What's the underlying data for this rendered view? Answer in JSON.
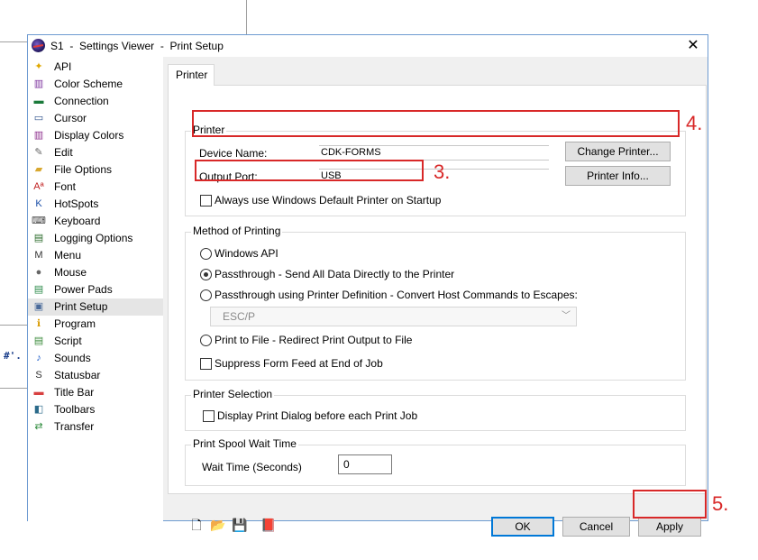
{
  "background": {
    "snippet_text": "#'."
  },
  "window": {
    "title": "S1  -  Settings Viewer  -  Print Setup",
    "close_symbol": "✕"
  },
  "sidebar": {
    "items": [
      {
        "label": "API",
        "icon": "api-icon",
        "glyph": "✦",
        "color": "#e0a800"
      },
      {
        "label": "Color Scheme",
        "icon": "color-scheme-icon",
        "glyph": "▥",
        "color": "#7a2f9c"
      },
      {
        "label": "Connection",
        "icon": "connection-icon",
        "glyph": "▬",
        "color": "#1a7a3a"
      },
      {
        "label": "Cursor",
        "icon": "cursor-icon",
        "glyph": "▭",
        "color": "#2b4f8a"
      },
      {
        "label": "Display Colors",
        "icon": "display-colors-icon",
        "glyph": "▥",
        "color": "#8a2b8a"
      },
      {
        "label": "Edit",
        "icon": "edit-icon",
        "glyph": "✎",
        "color": "#666666"
      },
      {
        "label": "File Options",
        "icon": "file-options-icon",
        "glyph": "▰",
        "color": "#d8a830"
      },
      {
        "label": "Font",
        "icon": "font-icon",
        "glyph": "Aª",
        "color": "#c02020"
      },
      {
        "label": "HotSpots",
        "icon": "hotspots-icon",
        "glyph": "K",
        "color": "#1a4fa8"
      },
      {
        "label": "Keyboard",
        "icon": "keyboard-icon",
        "glyph": "⌨",
        "color": "#444444"
      },
      {
        "label": "Logging Options",
        "icon": "logging-options-icon",
        "glyph": "▤",
        "color": "#2b6b2b"
      },
      {
        "label": "Menu",
        "icon": "menu-icon",
        "glyph": "M",
        "color": "#333333"
      },
      {
        "label": "Mouse",
        "icon": "mouse-icon",
        "glyph": "●",
        "color": "#666666"
      },
      {
        "label": "Power Pads",
        "icon": "power-pads-icon",
        "glyph": "▤",
        "color": "#2b8a4a"
      },
      {
        "label": "Print Setup",
        "icon": "print-setup-icon",
        "glyph": "▣",
        "color": "#4a6a9a"
      },
      {
        "label": "Program",
        "icon": "program-icon",
        "glyph": "ℹ",
        "color": "#d89a00"
      },
      {
        "label": "Script",
        "icon": "script-icon",
        "glyph": "▤",
        "color": "#3a8a3a"
      },
      {
        "label": "Sounds",
        "icon": "sounds-icon",
        "glyph": "♪",
        "color": "#1a5ac8"
      },
      {
        "label": "Statusbar",
        "icon": "statusbar-icon",
        "glyph": "S",
        "color": "#333333"
      },
      {
        "label": "Title Bar",
        "icon": "title-bar-icon",
        "glyph": "▬",
        "color": "#d84040"
      },
      {
        "label": "Toolbars",
        "icon": "toolbars-icon",
        "glyph": "◧",
        "color": "#2b6a8a"
      },
      {
        "label": "Transfer",
        "icon": "transfer-icon",
        "glyph": "⇄",
        "color": "#2b8a3a"
      }
    ],
    "selected_index": 14
  },
  "tab": {
    "label": "Printer"
  },
  "printer_group": {
    "title": "Printer",
    "device_name_label": "Device Name:",
    "device_name_value": "CDK-FORMS",
    "output_port_label": "Output Port:",
    "output_port_value": "USB",
    "change_printer_button": "Change Printer...",
    "printer_info_button": "Printer Info...",
    "always_default_label": "Always use Windows Default Printer on Startup",
    "always_default_checked": false
  },
  "method_group": {
    "title": "Method of Printing",
    "options": [
      {
        "label": "Windows API",
        "checked": false
      },
      {
        "label": "Passthrough  -  Send All Data Directly to the Printer",
        "checked": true
      },
      {
        "label": "Passthrough using Printer Definition  -  Convert Host Commands to Escapes:",
        "checked": false
      },
      {
        "label": "Print to File  -  Redirect Print Output to File",
        "checked": false
      }
    ],
    "definition_select_value": "ESC/P",
    "suppress_form_feed_label": "Suppress Form Feed at End of Job",
    "suppress_form_feed_checked": false
  },
  "selection_group": {
    "title": "Printer Selection",
    "display_dialog_label": "Display Print Dialog before each Print Job",
    "display_dialog_checked": false
  },
  "spool_group": {
    "title": "Print Spool Wait Time",
    "wait_time_label": "Wait Time (Seconds)",
    "wait_time_value": "0"
  },
  "footer": {
    "ok_button": "OK",
    "cancel_button": "Cancel",
    "apply_button": "Apply",
    "tools": [
      "new-file-icon",
      "open-folder-icon",
      "save-icon",
      "book-icon"
    ]
  },
  "annotations": {
    "label_3": "3.",
    "label_4": "4.",
    "label_5": "5.",
    "color": "#d82828"
  }
}
